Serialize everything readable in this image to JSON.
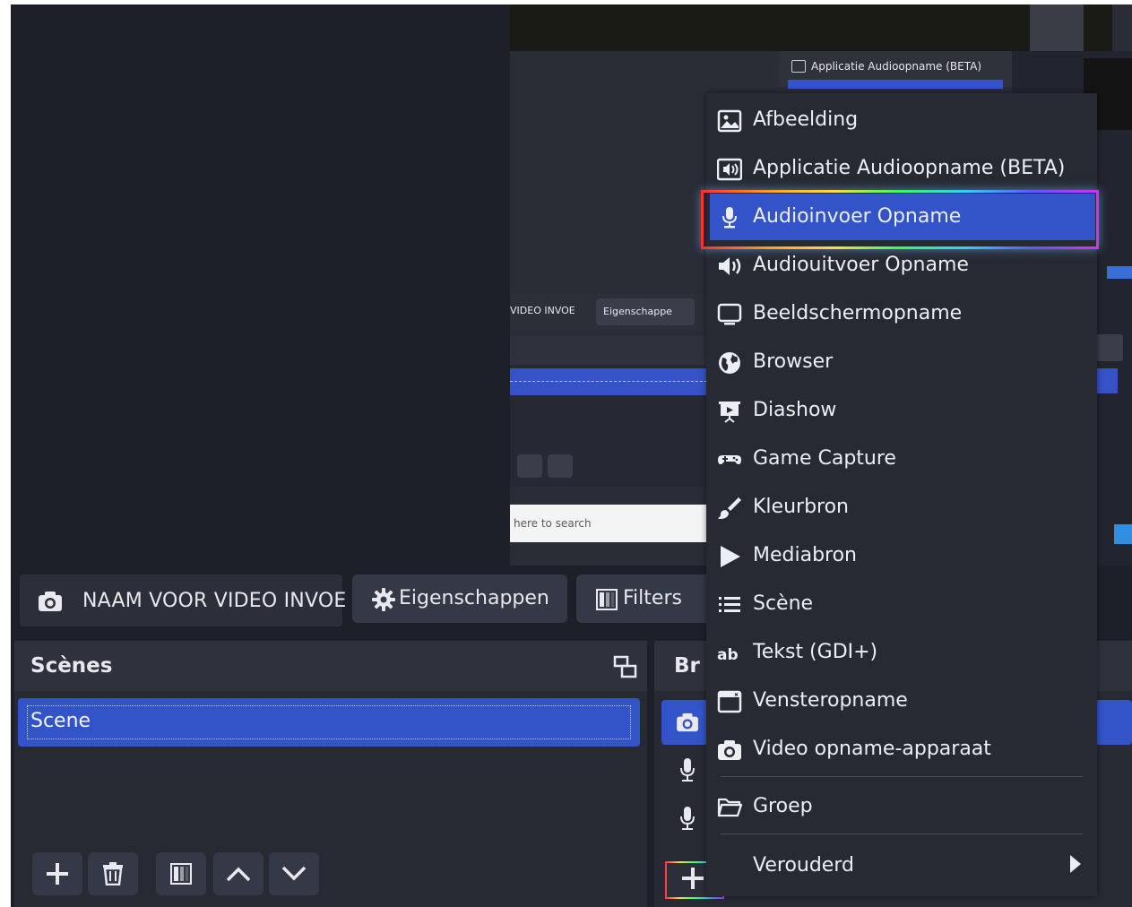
{
  "source_toolbar": {
    "source_name": "NAAM VOOR VIDEO INVOE",
    "properties_label": "Eigenschappen",
    "filters_label": "Filters"
  },
  "nested_screenshot": {
    "menu_label": "Applicatie Audioopname (BETA)",
    "toolbar_label": "VIDEO INVOE",
    "toolbar_button": "Eigenschappe",
    "search_placeholder": "here to search"
  },
  "scenes": {
    "title": "Scènes",
    "items": [
      "Scene"
    ]
  },
  "sources": {
    "title": "Br"
  },
  "context_menu": {
    "items": [
      {
        "label": "Afbeelding",
        "icon": "image-icon"
      },
      {
        "label": "Applicatie Audioopname (BETA)",
        "icon": "app-audio-icon"
      },
      {
        "label": "Audioinvoer Opname",
        "icon": "microphone-icon",
        "selected": true
      },
      {
        "label": "Audiouitvoer Opname",
        "icon": "speaker-icon"
      },
      {
        "label": "Beeldschermopname",
        "icon": "monitor-icon"
      },
      {
        "label": "Browser",
        "icon": "globe-icon"
      },
      {
        "label": "Diashow",
        "icon": "slideshow-icon"
      },
      {
        "label": "Game Capture",
        "icon": "gamepad-icon"
      },
      {
        "label": "Kleurbron",
        "icon": "paintbrush-icon"
      },
      {
        "label": "Mediabron",
        "icon": "play-icon"
      },
      {
        "label": "Scène",
        "icon": "list-icon"
      },
      {
        "label": "Tekst (GDI+)",
        "icon": "text-icon"
      },
      {
        "label": "Vensteropname",
        "icon": "window-icon"
      },
      {
        "label": "Video opname-apparaat",
        "icon": "camera-icon"
      }
    ],
    "group": {
      "label": "Groep",
      "icon": "folder-icon"
    },
    "deprecated": {
      "label": "Verouderd",
      "icon": "submenu-arrow-icon"
    }
  },
  "colors": {
    "background": "#1e2029",
    "panel": "#272a33",
    "accent": "#3353c9"
  }
}
